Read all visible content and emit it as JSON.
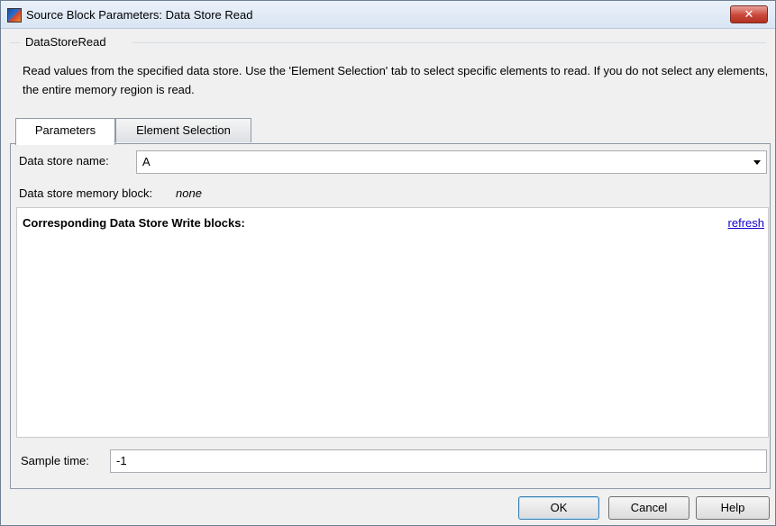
{
  "window": {
    "title": "Source Block Parameters: Data Store Read",
    "close_symbol": "✕",
    "app_icon": "simulink-block-icon"
  },
  "block": {
    "name": "DataStoreRead",
    "description": "Read values from the specified data store. Use the 'Element Selection' tab to select specific elements to read. If you do not select any elements, the entire memory region is read."
  },
  "tabs": [
    {
      "label": "Parameters",
      "active": true
    },
    {
      "label": "Element Selection",
      "active": false
    }
  ],
  "parameters": {
    "data_store_name_label": "Data store name:",
    "data_store_name_value": "A",
    "memory_block_label": "Data store memory block:",
    "memory_block_value": "none",
    "write_blocks_heading": "Corresponding Data Store Write blocks:",
    "refresh_label": "refresh",
    "sample_time_label": "Sample time:",
    "sample_time_value": "-1"
  },
  "buttons": {
    "ok": "OK",
    "cancel": "Cancel",
    "help": "Help"
  }
}
